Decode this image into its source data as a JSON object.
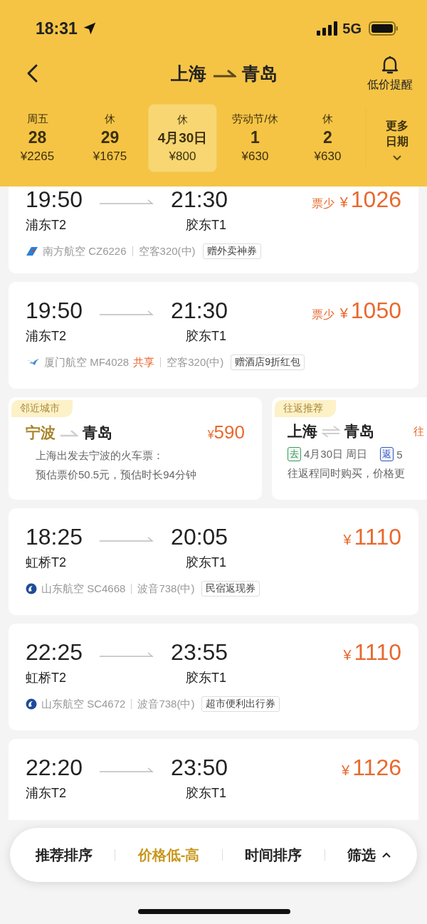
{
  "status_bar": {
    "time": "18:31",
    "network": "5G"
  },
  "header": {
    "from": "上海",
    "to": "青岛",
    "alert_label": "低价提醒"
  },
  "dates": [
    {
      "top": "周五",
      "day": "28",
      "price": "¥2265",
      "selected": false
    },
    {
      "top": "休",
      "day": "29",
      "price": "¥1675",
      "selected": false
    },
    {
      "top": "休",
      "day": "4月30日",
      "price": "¥800",
      "selected": true
    },
    {
      "top": "劳动节/休",
      "day": "1",
      "price": "¥630",
      "selected": false
    },
    {
      "top": "休",
      "day": "2",
      "price": "¥630",
      "selected": false
    }
  ],
  "more_dates": "更多日期",
  "items": [
    {
      "kind": "flight",
      "depart_time": "19:50",
      "arrive_time": "21:30",
      "depart_airport": "浦东T2",
      "arrive_airport": "胶东T1",
      "scarcity": "票少",
      "currency": "¥",
      "price": "1026",
      "logo": {
        "kind": "tail"
      },
      "airline": "南方航空 CZ6226",
      "aircraft": "空客320(中)",
      "perk": "赠外卖神券"
    },
    {
      "kind": "flight",
      "depart_time": "19:50",
      "arrive_time": "21:30",
      "depart_airport": "浦东T2",
      "arrive_airport": "胶东T1",
      "scarcity": "票少",
      "currency": "¥",
      "price": "1050",
      "logo": {
        "kind": "bird"
      },
      "airline": "厦门航空 MF4028",
      "share": "共享",
      "aircraft": "空客320(中)",
      "perk": "赠酒店9折红包"
    },
    {
      "kind": "promos",
      "nearby": {
        "tag": "邻近城市",
        "from": "宁波",
        "to": "青岛",
        "currency": "¥",
        "price": "590",
        "lines": [
          "上海出发去宁波的火车票：",
          "预估票价50.5元，预估时长94分钟"
        ]
      },
      "round_trip": {
        "tag": "往返推荐",
        "from": "上海",
        "to": "青岛",
        "price_label": "往",
        "outbound_badge": "去",
        "outbound_date": "4月30日 周日",
        "return_badge": "返",
        "return_date": "5",
        "note": "往返程同时购买，价格更"
      }
    },
    {
      "kind": "flight",
      "depart_time": "18:25",
      "arrive_time": "20:05",
      "depart_airport": "虹桥T2",
      "arrive_airport": "胶东T1",
      "currency": "¥",
      "price": "1110",
      "logo": {
        "kind": "swirl"
      },
      "airline": "山东航空 SC4668",
      "aircraft": "波音738(中)",
      "perk": "民宿返现券"
    },
    {
      "kind": "flight",
      "depart_time": "22:25",
      "arrive_time": "23:55",
      "depart_airport": "虹桥T2",
      "arrive_airport": "胶东T1",
      "currency": "¥",
      "price": "1110",
      "logo": {
        "kind": "swirl"
      },
      "airline": "山东航空 SC4672",
      "aircraft": "波音738(中)",
      "perk": "超市便利出行券"
    },
    {
      "kind": "flight",
      "depart_time": "22:20",
      "arrive_time": "23:50",
      "depart_airport": "浦东T2",
      "arrive_airport": "胶东T1",
      "currency": "¥",
      "price": "1126"
    }
  ],
  "sort_bar": {
    "options": [
      {
        "label": "推荐排序",
        "selected": false
      },
      {
        "label": "价格低-高",
        "selected": true
      },
      {
        "label": "时间排序",
        "selected": false
      }
    ],
    "filter": "筛选"
  }
}
